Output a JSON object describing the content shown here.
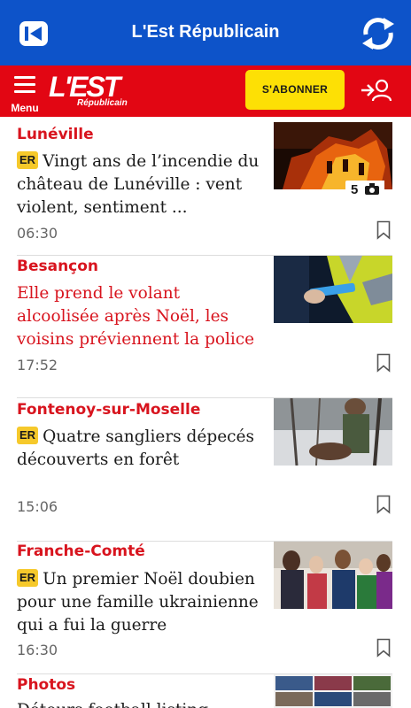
{
  "appbar": {
    "title": "L'Est Républicain"
  },
  "header": {
    "menu_label": "Menu",
    "logo_main": "L'EST",
    "logo_sub": "Républicain",
    "subscribe_label": "S'ABONNER"
  },
  "articles": [
    {
      "category": "Lunéville",
      "badge": "ER",
      "headline": "Vingt ans de l’incendie du château de Lunéville : vent violent, sentiment ...",
      "time": "06:30",
      "photo_count": "5"
    },
    {
      "category": "Besançon",
      "headline": "Elle prend le volant alcoolisée après Noël, les voisins préviennent la police",
      "time": "17:52"
    },
    {
      "category": "Fontenoy-sur-Moselle",
      "badge": "ER",
      "headline": "Quatre sangliers dépecés découverts en forêt",
      "time": "15:06"
    },
    {
      "category": "Franche-Comté",
      "badge": "ER",
      "headline": "Un premier Noël doubien pour une famille ukrainienne qui a fui la guerre",
      "time": "16:30"
    },
    {
      "category": "Photos",
      "headline": "Détours football listing"
    }
  ],
  "colors": {
    "appbar": "#0d53c9",
    "header": "#e20613",
    "accent_red": "#d8141e",
    "subscribe": "#fde005",
    "er_badge": "#f6c92b"
  }
}
